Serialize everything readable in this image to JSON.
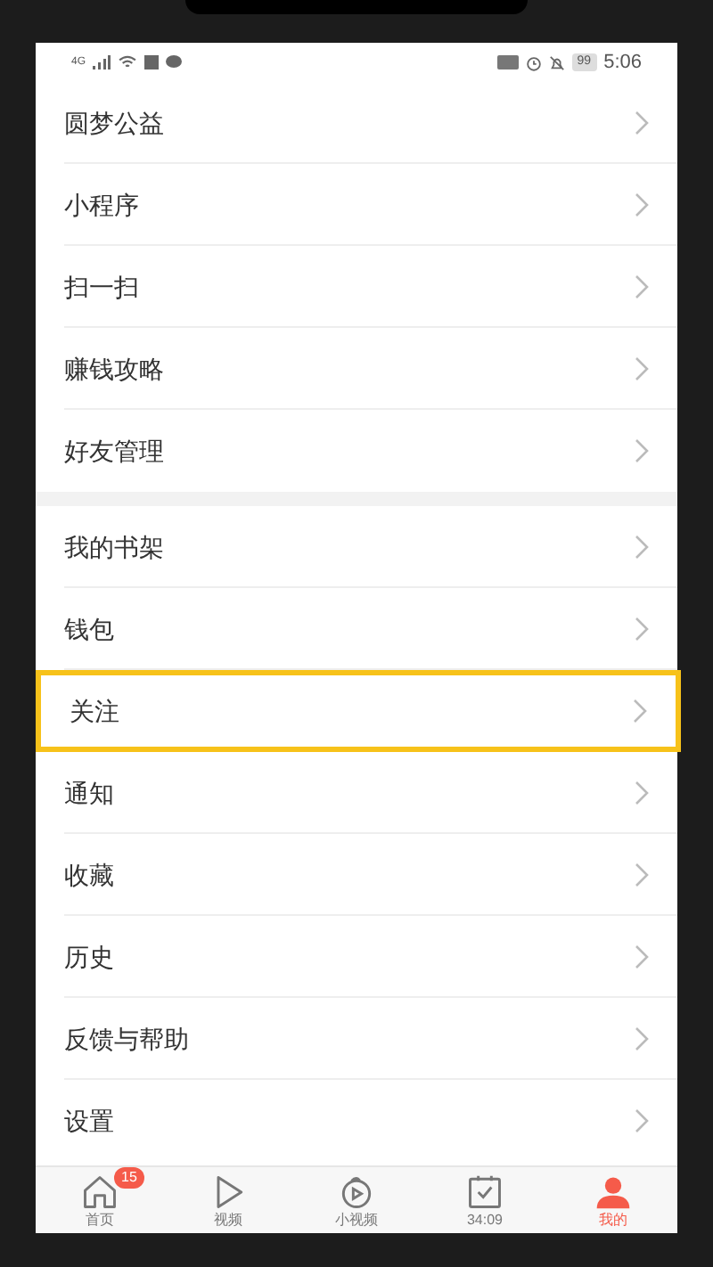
{
  "status_bar": {
    "network": "4G",
    "battery": "99",
    "time": "5:06"
  },
  "sections": [
    {
      "items": [
        {
          "label": "圆梦公益",
          "highlighted": false
        },
        {
          "label": "小程序",
          "highlighted": false
        },
        {
          "label": "扫一扫",
          "highlighted": false
        },
        {
          "label": "赚钱攻略",
          "highlighted": false
        },
        {
          "label": "好友管理",
          "highlighted": false
        }
      ]
    },
    {
      "items": [
        {
          "label": "我的书架",
          "highlighted": false
        },
        {
          "label": "钱包",
          "highlighted": false
        },
        {
          "label": "关注",
          "highlighted": true
        },
        {
          "label": "通知",
          "highlighted": false
        },
        {
          "label": "收藏",
          "highlighted": false
        },
        {
          "label": "历史",
          "highlighted": false
        },
        {
          "label": "反馈与帮助",
          "highlighted": false
        },
        {
          "label": "设置",
          "highlighted": false
        }
      ]
    }
  ],
  "tab_bar": [
    {
      "kind": "home",
      "label": "首页",
      "badge": "15",
      "selected": false
    },
    {
      "kind": "video",
      "label": "视频",
      "selected": false
    },
    {
      "kind": "short",
      "label": "小视频",
      "selected": false
    },
    {
      "kind": "task",
      "label": "34:09",
      "selected": false
    },
    {
      "kind": "me",
      "label": "我的",
      "selected": true
    }
  ]
}
